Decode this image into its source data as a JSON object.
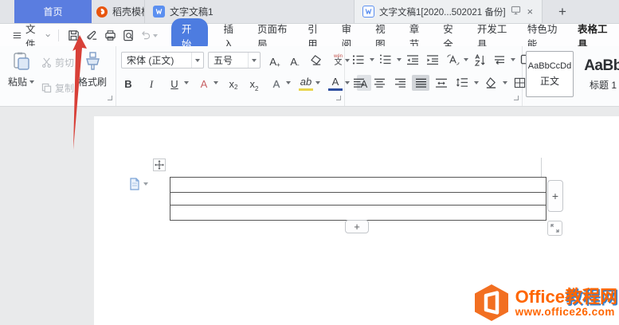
{
  "colors": {
    "home_tab_blue": "#5a7de0",
    "accent_blue": "#4d7ce0",
    "docer_orange": "#e8550e",
    "watermark_orange": "#ff6600",
    "watermark_blue": "#2f7fd0",
    "arrow_red": "#d84038"
  },
  "tab_bar": {
    "tabs": [
      {
        "label": "首页",
        "active": false
      },
      {
        "label": "稻壳模板",
        "icon": "docer-logo"
      },
      {
        "label": "文字文稿1",
        "icon": "wps-writer-logo"
      },
      {
        "label": "文字文稿1[2020...502021 备份]",
        "icon": "wps-writer-logo",
        "sync_icon": "monitor",
        "close_glyph": "×",
        "active": true
      }
    ],
    "new_tab_glyph": "+"
  },
  "menu_bar": {
    "file_label": "文件",
    "quick_actions": [
      {
        "icon": "save-icon"
      },
      {
        "icon": "export-pdf-icon"
      },
      {
        "icon": "print-icon"
      },
      {
        "icon": "print-preview-icon"
      },
      {
        "icon": "undo-icon",
        "disabled": true
      }
    ],
    "items": [
      {
        "label": "开始",
        "active": true
      },
      {
        "label": "插入"
      },
      {
        "label": "页面布局"
      },
      {
        "label": "引用"
      },
      {
        "label": "审阅"
      },
      {
        "label": "视图"
      },
      {
        "label": "章节"
      },
      {
        "label": "安全"
      },
      {
        "label": "开发工具"
      },
      {
        "label": "特色功能"
      },
      {
        "label": "表格工具",
        "emphasis": true
      }
    ]
  },
  "ribbon": {
    "clipboard": {
      "paste_label": "粘贴",
      "cut_label": "剪切",
      "copy_label": "复制",
      "format_painter_label": "格式刷"
    },
    "font": {
      "family_value": "宋体 (正文)",
      "size_value": "五号",
      "grow_glyph": "A",
      "grow_sign": "+",
      "shrink_glyph": "A",
      "shrink_sign": "-",
      "pinyin_tone": "wén",
      "pinyin_base": "文",
      "bold_glyph": "B",
      "italic_glyph": "I",
      "underline_glyph": "U",
      "effect_glyph": "A",
      "superscript_glyph": "x",
      "superscript_sign": "2",
      "subscript_glyph": "x",
      "subscript_sign": "2",
      "outline_glyph": "A",
      "highlight_glyph": "ab",
      "color_glyph": "A",
      "shading_glyph": "A"
    },
    "styles": [
      {
        "sample": "AaBbCcDd",
        "name": "正文"
      },
      {
        "sample": "AaBb",
        "name": "标题 1"
      }
    ]
  },
  "document": {
    "table": {
      "rows": 3,
      "columns": 1
    },
    "add_row_glyph": "+",
    "add_column_glyph": "+"
  },
  "watermark": {
    "brand_en": "Office",
    "brand_cn": "教程网",
    "url": "www.office26.com"
  }
}
